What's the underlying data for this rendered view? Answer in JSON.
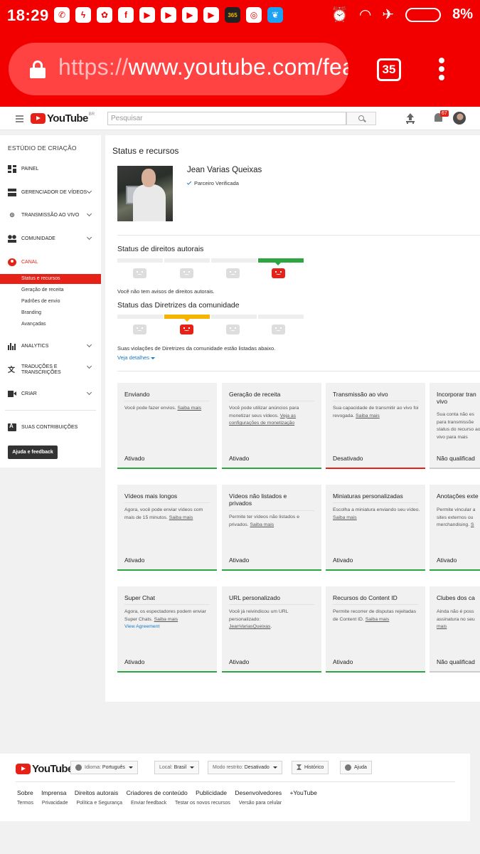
{
  "android": {
    "time": "18:29",
    "battery": "8%",
    "notif_icons": [
      "whatsapp-icon",
      "messenger-icon",
      "app-icon",
      "facebook-icon",
      "youtube-icon",
      "youtube-icon",
      "youtube-icon",
      "youtube-icon",
      "365-icon",
      "instagram-icon",
      "twitter-icon"
    ],
    "notif_badge_365": "365"
  },
  "browser": {
    "url_scheme": "https://",
    "url_rest": "www.youtube.com/fea",
    "tab_count": "35"
  },
  "header": {
    "logo_text": "YouTube",
    "logo_region": "BR",
    "search_placeholder": "Pesquisar",
    "notif_count": "67"
  },
  "sidebar": {
    "title": "ESTÚDIO DE CRIAÇÃO",
    "items": [
      {
        "label": "PAINEL",
        "icon": "dashboard-icon"
      },
      {
        "label": "GERENCIADOR DE VÍDEOS",
        "icon": "video-manager-icon"
      },
      {
        "label": "TRANSMISSÃO AO VIVO",
        "icon": "live-icon"
      },
      {
        "label": "COMUNIDADE",
        "icon": "community-icon"
      },
      {
        "label": "CANAL",
        "icon": "channel-icon"
      },
      {
        "label": "ANALYTICS",
        "icon": "analytics-icon"
      },
      {
        "label": "TRADUÇÕES E",
        "label2": "TRANSCRIÇÕES",
        "icon": "translate-icon"
      },
      {
        "label": "CRIAR",
        "icon": "create-icon"
      },
      {
        "label": "SUAS CONTRIBUIÇÕES",
        "icon": "contributions-icon"
      }
    ],
    "channel_sub": [
      "Status e recursos",
      "Geração de receita",
      "Padrões de envio",
      "Branding",
      "Avançadas"
    ],
    "help_button": "Ajuda e feedback"
  },
  "main": {
    "title": "Status e recursos",
    "channel_name": "Jean Varias Queixas",
    "verified_label": "Parceiro Verificada",
    "copyright": {
      "title": "Status de direitos autorais",
      "note": "Você não tem avisos de direitos autorais.",
      "active_segment": 4
    },
    "community": {
      "title": "Status das Diretrizes da comunidade",
      "note": "Suas violações de Diretrizes da comunidade estão listadas abaixo.",
      "details_link": "Veja detalhes",
      "active_segment": 2
    },
    "features": [
      {
        "title": "Enviando",
        "desc": "Você pode fazer envios.",
        "link": "Saiba mais",
        "status": "Ativado",
        "bar": "green"
      },
      {
        "title": "Geração de receita",
        "desc": "Você pode utilizar anúncios para monetizar seus vídeos.",
        "link": "Veja as configurações de monetização",
        "status": "Ativado",
        "bar": "green"
      },
      {
        "title": "Transmissão ao vivo",
        "desc": "Sua capacidade de transmitir ao vivo foi revogada.",
        "link": "Saiba mais",
        "status": "Desativado",
        "bar": "red"
      },
      {
        "title": "Incorporar tran",
        "title2": "vivo",
        "desc": "Sua conta não es para transmissõe status do recurso ao vivo para mais",
        "link": "",
        "status": "Não qualificad",
        "bar": "grey"
      },
      {
        "title": "Vídeos mais longos",
        "desc": "Agora, você pode enviar vídeos com mais de 15 minutos.",
        "link": "Saiba mais",
        "status": "Ativado",
        "bar": "green"
      },
      {
        "title": "Vídeos não listados e",
        "title2": "privados",
        "desc": "Permite ter vídeos não listados e privados.",
        "link": "Saiba mais",
        "status": "Ativado",
        "bar": "green"
      },
      {
        "title": "Miniaturas personalizadas",
        "desc": "Escolha a miniatura enviando seu vídeo.",
        "link": "Saiba mais",
        "status": "Ativado",
        "bar": "green"
      },
      {
        "title": "Anotações exte",
        "desc": "Permite vincular a sites externos ou merchandising.",
        "link": "S",
        "status": "Ativado",
        "bar": "green"
      },
      {
        "title": "Super Chat",
        "desc": "Agora, os espectadores podem enviar Super Chats.",
        "link": "Saiba mais",
        "extra": "View Agreement",
        "status": "Ativado",
        "bar": "green"
      },
      {
        "title": "URL personalizado",
        "desc": "Você já reivindicou um URL personalizado:",
        "link": "JeanVariasQueixas",
        "status": "Ativado",
        "bar": "green"
      },
      {
        "title": "Recursos do Content ID",
        "desc": "Permite recorrer de disputas rejeitadas de Content ID.",
        "link": "Saiba mais",
        "status": "Ativado",
        "bar": "green"
      },
      {
        "title": "Clubes dos ca",
        "desc": "Ainda não é poss assinatura no seu",
        "link": "mais",
        "status": "Não qualificad",
        "bar": "grey"
      }
    ]
  },
  "footer": {
    "logo_text": "YouTube",
    "language_label": "Idioma:",
    "language_value": "Português",
    "location_label": "Local:",
    "location_value": "Brasil",
    "restricted_label": "Modo restrito:",
    "restricted_value": "Desativado",
    "history": "Histórico",
    "help": "Ajuda",
    "links": [
      "Sobre",
      "Imprensa",
      "Direitos autorais",
      "Criadores de conteúdo",
      "Publicidade",
      "Desenvolvedores",
      "+YouTube"
    ],
    "links2": [
      "Termos",
      "Privacidade",
      "Política e Segurança",
      "Enviar feedback",
      "Testar os novos recursos",
      "Versão para celular"
    ]
  }
}
